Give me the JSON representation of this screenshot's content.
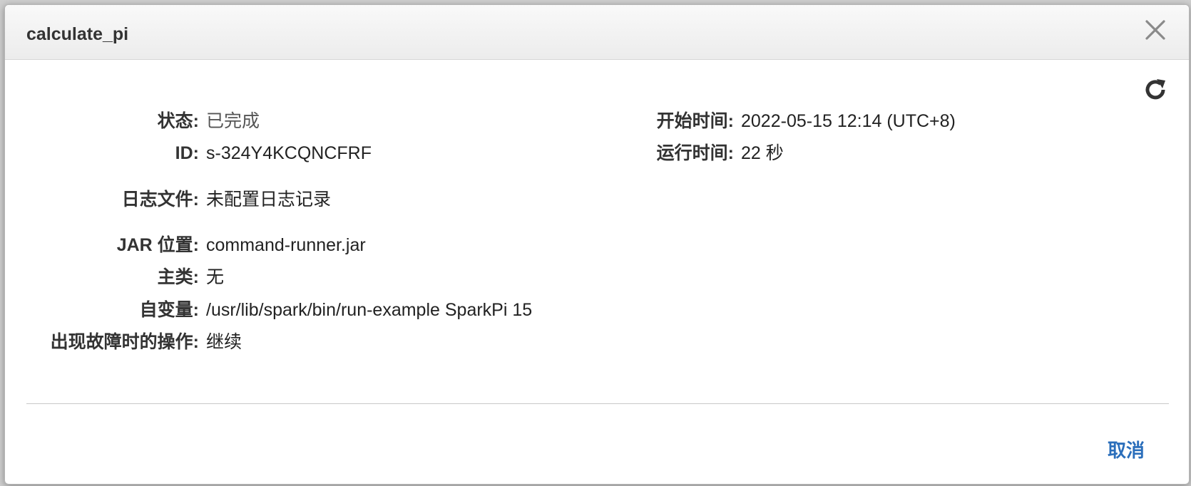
{
  "dialog": {
    "title": "calculate_pi",
    "close_icon": "close-icon",
    "refresh_icon": "refresh-icon",
    "cancel_label": "取消"
  },
  "details": {
    "status": {
      "label": "状态:",
      "value": "已完成"
    },
    "id": {
      "label": "ID:",
      "value": "s-324Y4KCQNCFRF"
    },
    "log_file": {
      "label": "日志文件:",
      "value": "未配置日志记录"
    },
    "jar_location": {
      "label": "JAR 位置:",
      "value": "command-runner.jar"
    },
    "main_class": {
      "label": "主类:",
      "value": "无"
    },
    "arguments": {
      "label": "自变量:",
      "value": "/usr/lib/spark/bin/run-example SparkPi 15"
    },
    "on_failure": {
      "label": "出现故障时的操作:",
      "value": "继续"
    },
    "start_time": {
      "label": "开始时间:",
      "value": "2022-05-15 12:14 (UTC+8)"
    },
    "run_time": {
      "label": "运行时间:",
      "value": "22 秒"
    }
  },
  "colors": {
    "link": "#2a6ebb",
    "label": "#333333",
    "header_bg": "#f0f0f0"
  }
}
